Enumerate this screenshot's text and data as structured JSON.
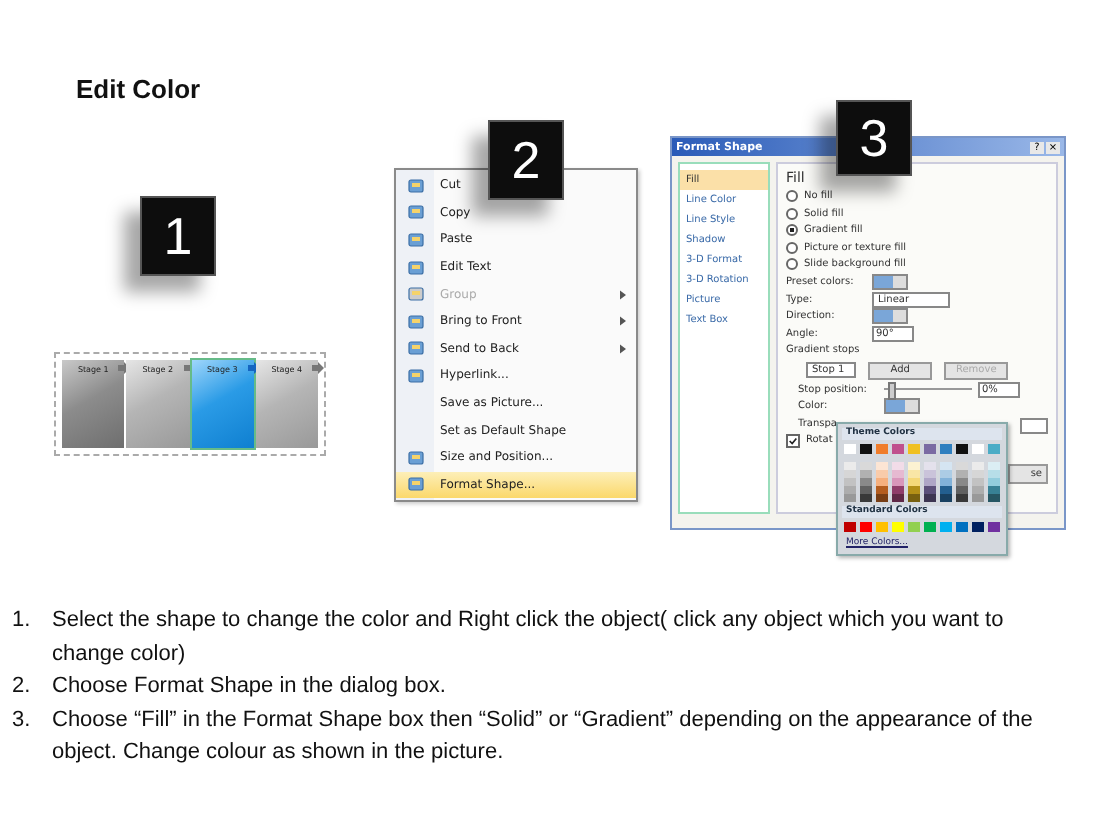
{
  "title": "Edit Color",
  "shape_panel": {
    "badge": "1",
    "stages": [
      {
        "label": "Stage 1",
        "selected": false
      },
      {
        "label": "Stage 2",
        "selected": false
      },
      {
        "label": "Stage 3",
        "selected": true
      },
      {
        "label": "Stage 4",
        "selected": false
      }
    ]
  },
  "context_menu": {
    "badge": "2",
    "items": [
      {
        "label": "Cut",
        "has_icon": true,
        "disabled": false,
        "submenu": false,
        "highlighted": false
      },
      {
        "label": "Copy",
        "has_icon": true,
        "disabled": false,
        "submenu": false,
        "highlighted": false
      },
      {
        "label": "Paste",
        "has_icon": true,
        "disabled": false,
        "submenu": false,
        "highlighted": false
      },
      {
        "label": "Edit Text",
        "has_icon": true,
        "disabled": false,
        "submenu": false,
        "highlighted": false
      },
      {
        "label": "Group",
        "has_icon": true,
        "disabled": true,
        "submenu": true,
        "highlighted": false
      },
      {
        "label": "Bring to Front",
        "has_icon": true,
        "disabled": false,
        "submenu": true,
        "highlighted": false
      },
      {
        "label": "Send to Back",
        "has_icon": true,
        "disabled": false,
        "submenu": true,
        "highlighted": false
      },
      {
        "label": "Hyperlink...",
        "has_icon": true,
        "disabled": false,
        "submenu": false,
        "highlighted": false
      },
      {
        "label": "Save as Picture...",
        "has_icon": false,
        "disabled": false,
        "submenu": false,
        "highlighted": false
      },
      {
        "label": "Set as Default Shape",
        "has_icon": false,
        "disabled": false,
        "submenu": false,
        "highlighted": false
      },
      {
        "label": "Size and Position...",
        "has_icon": true,
        "disabled": false,
        "submenu": false,
        "highlighted": false
      },
      {
        "label": "Format Shape...",
        "has_icon": true,
        "disabled": false,
        "submenu": false,
        "highlighted": true
      }
    ]
  },
  "dialog": {
    "badge": "3",
    "title": "Format Shape",
    "help": "?",
    "close": "×",
    "nav": [
      {
        "label": "Fill",
        "selected": true
      },
      {
        "label": "Line Color",
        "selected": false
      },
      {
        "label": "Line Style",
        "selected": false
      },
      {
        "label": "Shadow",
        "selected": false
      },
      {
        "label": "3-D Format",
        "selected": false
      },
      {
        "label": "3-D Rotation",
        "selected": false
      },
      {
        "label": "Picture",
        "selected": false
      },
      {
        "label": "Text Box",
        "selected": false
      }
    ],
    "heading": "Fill",
    "fill_options": [
      {
        "label": "No fill",
        "selected": false
      },
      {
        "label": "Solid fill",
        "selected": false
      },
      {
        "label": "Gradient fill",
        "selected": true
      },
      {
        "label": "Picture or texture fill",
        "selected": false
      },
      {
        "label": "Slide background fill",
        "selected": false
      }
    ],
    "preset_label": "Preset colors:",
    "type_label": "Type:",
    "type_value": "Linear",
    "direction_label": "Direction:",
    "angle_label": "Angle:",
    "angle_value": "90°",
    "stops_label": "Gradient stops",
    "stop_value": "Stop 1",
    "add_button": {
      "label": "Add",
      "disabled": false
    },
    "remove_button": {
      "label": "Remove",
      "disabled": true
    },
    "stop_position_label": "Stop position:",
    "stop_position": {
      "level": 0.05
    },
    "stop_position_value": "0%",
    "color_label": "Color:",
    "transparency_label": "Transpa",
    "rotate": {
      "label": "Rotat",
      "checked": true
    },
    "bottom_button": "se",
    "palette": {
      "theme_title": "Theme Colors",
      "theme": [
        {
          "color": "#ffffff"
        },
        {
          "color": "#111111"
        },
        {
          "color": "#f07c2a"
        },
        {
          "color": "#c0508d"
        },
        {
          "color": "#f0c020"
        },
        {
          "color": "#7a6aa2"
        },
        {
          "color": "#2f7fbf"
        },
        {
          "color": "#111111"
        },
        {
          "color": "#ffffff"
        },
        {
          "color": "#4bacc6"
        }
      ],
      "standard_title": "Standard Colors",
      "standard": [
        {
          "color": "#c00000"
        },
        {
          "color": "#ff0000"
        },
        {
          "color": "#ffc000"
        },
        {
          "color": "#ffff00"
        },
        {
          "color": "#92d050"
        },
        {
          "color": "#00b050"
        },
        {
          "color": "#00b0f0"
        },
        {
          "color": "#0070c0"
        },
        {
          "color": "#002060"
        },
        {
          "color": "#7030a0"
        }
      ],
      "more": "More Colors..."
    }
  },
  "instructions": [
    {
      "number": "1.",
      "text": "Select the shape to change the color and Right click the object( click any object which you want to change color)"
    },
    {
      "number": "2.",
      "text": "Choose Format Shape in the dialog box."
    },
    {
      "number": "3.",
      "text": "Choose “Fill” in the Format Shape box then “Solid” or “Gradient” depending on the appearance of the object. Change colour as shown in the picture."
    }
  ]
}
